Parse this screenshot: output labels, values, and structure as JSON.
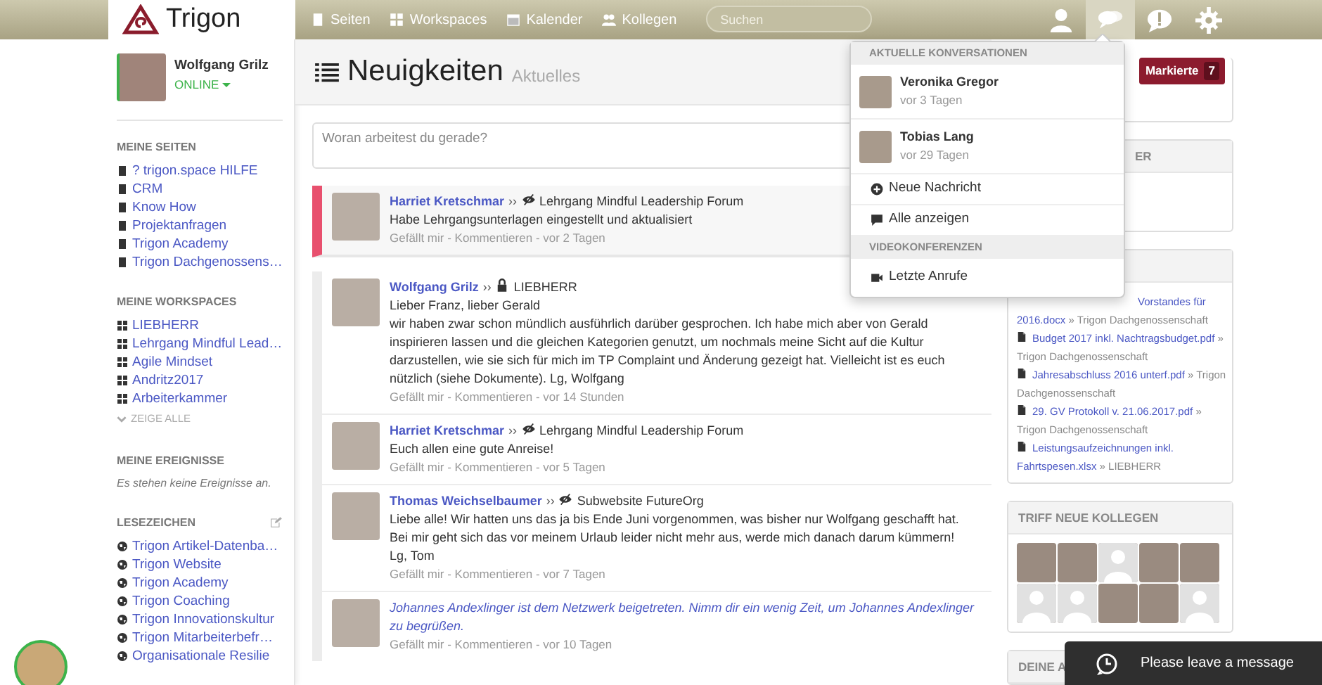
{
  "navbar": {
    "logo": "Trigon",
    "links": [
      {
        "label": "Seiten"
      },
      {
        "label": "Workspaces"
      },
      {
        "label": "Kalender"
      },
      {
        "label": "Kollegen"
      }
    ],
    "search": {
      "placeholder": "Suchen"
    },
    "icons": [
      {
        "kind": "user",
        "selected": false
      },
      {
        "kind": "chat",
        "selected": true
      },
      {
        "kind": "alert",
        "selected": false
      },
      {
        "kind": "settings",
        "selected": false
      }
    ]
  },
  "profile": {
    "name": "Wolfgang Grilz",
    "status": "ONLINE"
  },
  "sidebar": [
    {
      "title": "MEINE SEITEN",
      "kind": "pages",
      "items": [
        "? trigon.space HILFE",
        "CRM",
        "Know How",
        "Projektanfragen",
        "Trigon Academy",
        "Trigon Dachgenossens…"
      ]
    },
    {
      "title": "MEINE WORKSPACES",
      "kind": "workspaces",
      "items": [
        "LIEBHERR",
        "Lehrgang Mindful Lead…",
        "Agile Mindset",
        "Andritz2017",
        "Arbeiterkammer"
      ],
      "more": "ZEIGE ALLE"
    },
    {
      "title": "MEINE EREIGNISSE",
      "kind": "note",
      "note": "Es stehen keine Ereignisse an."
    },
    {
      "title": "LESEZEICHEN",
      "kind": "bookmarks",
      "items": [
        "Trigon Artikel-Datenba…",
        "Trigon Website",
        "Trigon Academy",
        "Trigon Coaching",
        "Trigon Innovationskultur",
        "Trigon Mitarbeiterbefr…",
        "Organisationale Resilie"
      ]
    }
  ],
  "main": {
    "title": "Neuigkeiten",
    "subtitle": "Aktuelles",
    "composer": {
      "placeholder": "Woran arbeitest du gerade?"
    },
    "posts": [
      {
        "kind": "post",
        "highlighted": true,
        "author": "Harriet Kretschmar",
        "arrow": "››",
        "private": false,
        "target": "Lehrgang Mindful Leadership Forum",
        "lines": [
          "Habe Lehrgangsunterlagen eingestellt und aktualisiert"
        ],
        "like": "Gefällt mir",
        "sep1": "-",
        "comment": "Kommentieren",
        "sep2": "-",
        "time": "vor 2 Tagen"
      },
      {
        "kind": "post",
        "highlighted": false,
        "author": "Wolfgang Grilz",
        "arrow": "››",
        "private": true,
        "target": "LIEBHERR",
        "lines": [
          "Lieber Franz, lieber Gerald",
          "wir haben zwar schon mündlich ausführlich darüber gesprochen. Ich habe mich aber von Gerald inspirieren lassen und die gleichen Kategorien genutzt, um nochmals meine Sicht auf die Kultur darzustellen, wie sie sich für mich im TP Complaint und Änderung gezeigt hat. Vielleicht ist es euch nützlich (siehe Dokumente). Lg, Wolfgang"
        ],
        "like": "Gefällt mir",
        "sep1": "-",
        "comment": "Kommentieren",
        "sep2": "-",
        "time": "vor 14 Stunden"
      },
      {
        "kind": "post",
        "highlighted": false,
        "author": "Harriet Kretschmar",
        "arrow": "››",
        "private": false,
        "target": "Lehrgang Mindful Leadership Forum",
        "lines": [
          "Euch allen eine gute Anreise!"
        ],
        "like": "Gefällt mir",
        "sep1": "-",
        "comment": "Kommentieren",
        "sep2": "-",
        "time": "vor 5 Tagen"
      },
      {
        "kind": "post",
        "highlighted": false,
        "author": "Thomas Weichselbaumer",
        "arrow": "››",
        "private": false,
        "target": "Subwebsite FutureOrg",
        "lines": [
          "Liebe alle! Wir hatten uns das ja bis Ende Juni vorgenommen, was bisher nur Wolfgang geschafft hat. Bei mir geht sich das vor meinem Urlaub leider nicht mehr aus, werde mich danach darum kümmern!",
          "Lg, Tom"
        ],
        "like": "Gefällt mir",
        "sep1": "-",
        "comment": "Kommentieren",
        "sep2": "-",
        "time": "vor 7 Tagen"
      },
      {
        "kind": "join",
        "highlighted": false,
        "lines": [
          "Johannes Andexlinger ist dem Netzwerk beigetreten. Nimm dir ein wenig Zeit, um Johannes Andexlinger zu begrüßen."
        ],
        "like": "Gefällt mir",
        "sep1": "-",
        "comment": "Kommentieren",
        "sep2": "-",
        "time": "vor 10 Tagen"
      }
    ]
  },
  "right": {
    "flag_button": {
      "label": "Markierte",
      "count": "7"
    },
    "card2_header": "ER",
    "documents": [
      {
        "file": "Vorstandes für 2016.docx",
        "sep": "»",
        "place": "Trigon Dachgenossenschaft"
      },
      {
        "file": "Budget 2017 inkl. Nachtragsbudget.pdf",
        "sep": "»",
        "place": "Trigon Dachgenossenschaft"
      },
      {
        "file": "Jahresabschluss 2016 unterf.pdf",
        "sep": "»",
        "place": "Trigon Dachgenossenschaft"
      },
      {
        "file": "29. GV Protokoll v. 21.06.2017.pdf",
        "sep": "»",
        "place": "Trigon Dachgenossenschaft"
      },
      {
        "file": "Leistungsaufzeichnungen inkl. Fahrtspesen.xlsx",
        "sep": "»",
        "place": "LIEBHERR"
      }
    ],
    "colleagues": {
      "title": "TRIFF NEUE KOLLEGEN",
      "people": [
        {
          "kind": "photo"
        },
        {
          "kind": "photo"
        },
        {
          "kind": "blank"
        },
        {
          "kind": "photo"
        },
        {
          "kind": "photo"
        },
        {
          "kind": "blank"
        },
        {
          "kind": "blank"
        },
        {
          "kind": "photo"
        },
        {
          "kind": "photo"
        },
        {
          "kind": "blank"
        }
      ]
    },
    "last_header": "DEINE A"
  },
  "dropdown": {
    "sections": [
      {
        "title": "AKTUELLE KONVERSATIONEN",
        "items": [
          {
            "kind": "conversation",
            "name": "Veronika Gregor",
            "time": "vor 3 Tagen"
          },
          {
            "kind": "conversation",
            "name": "Tobias Lang",
            "time": "vor 29 Tagen"
          },
          {
            "kind": "action",
            "label": "Neue Nachricht"
          },
          {
            "kind": "action",
            "label": "Alle anzeigen"
          }
        ]
      },
      {
        "title": "VIDEOKONFERENZEN",
        "items": [
          {
            "kind": "action",
            "label": "Letzte Anrufe"
          }
        ]
      }
    ]
  },
  "chat_widget": {
    "label": "Please leave a message"
  }
}
